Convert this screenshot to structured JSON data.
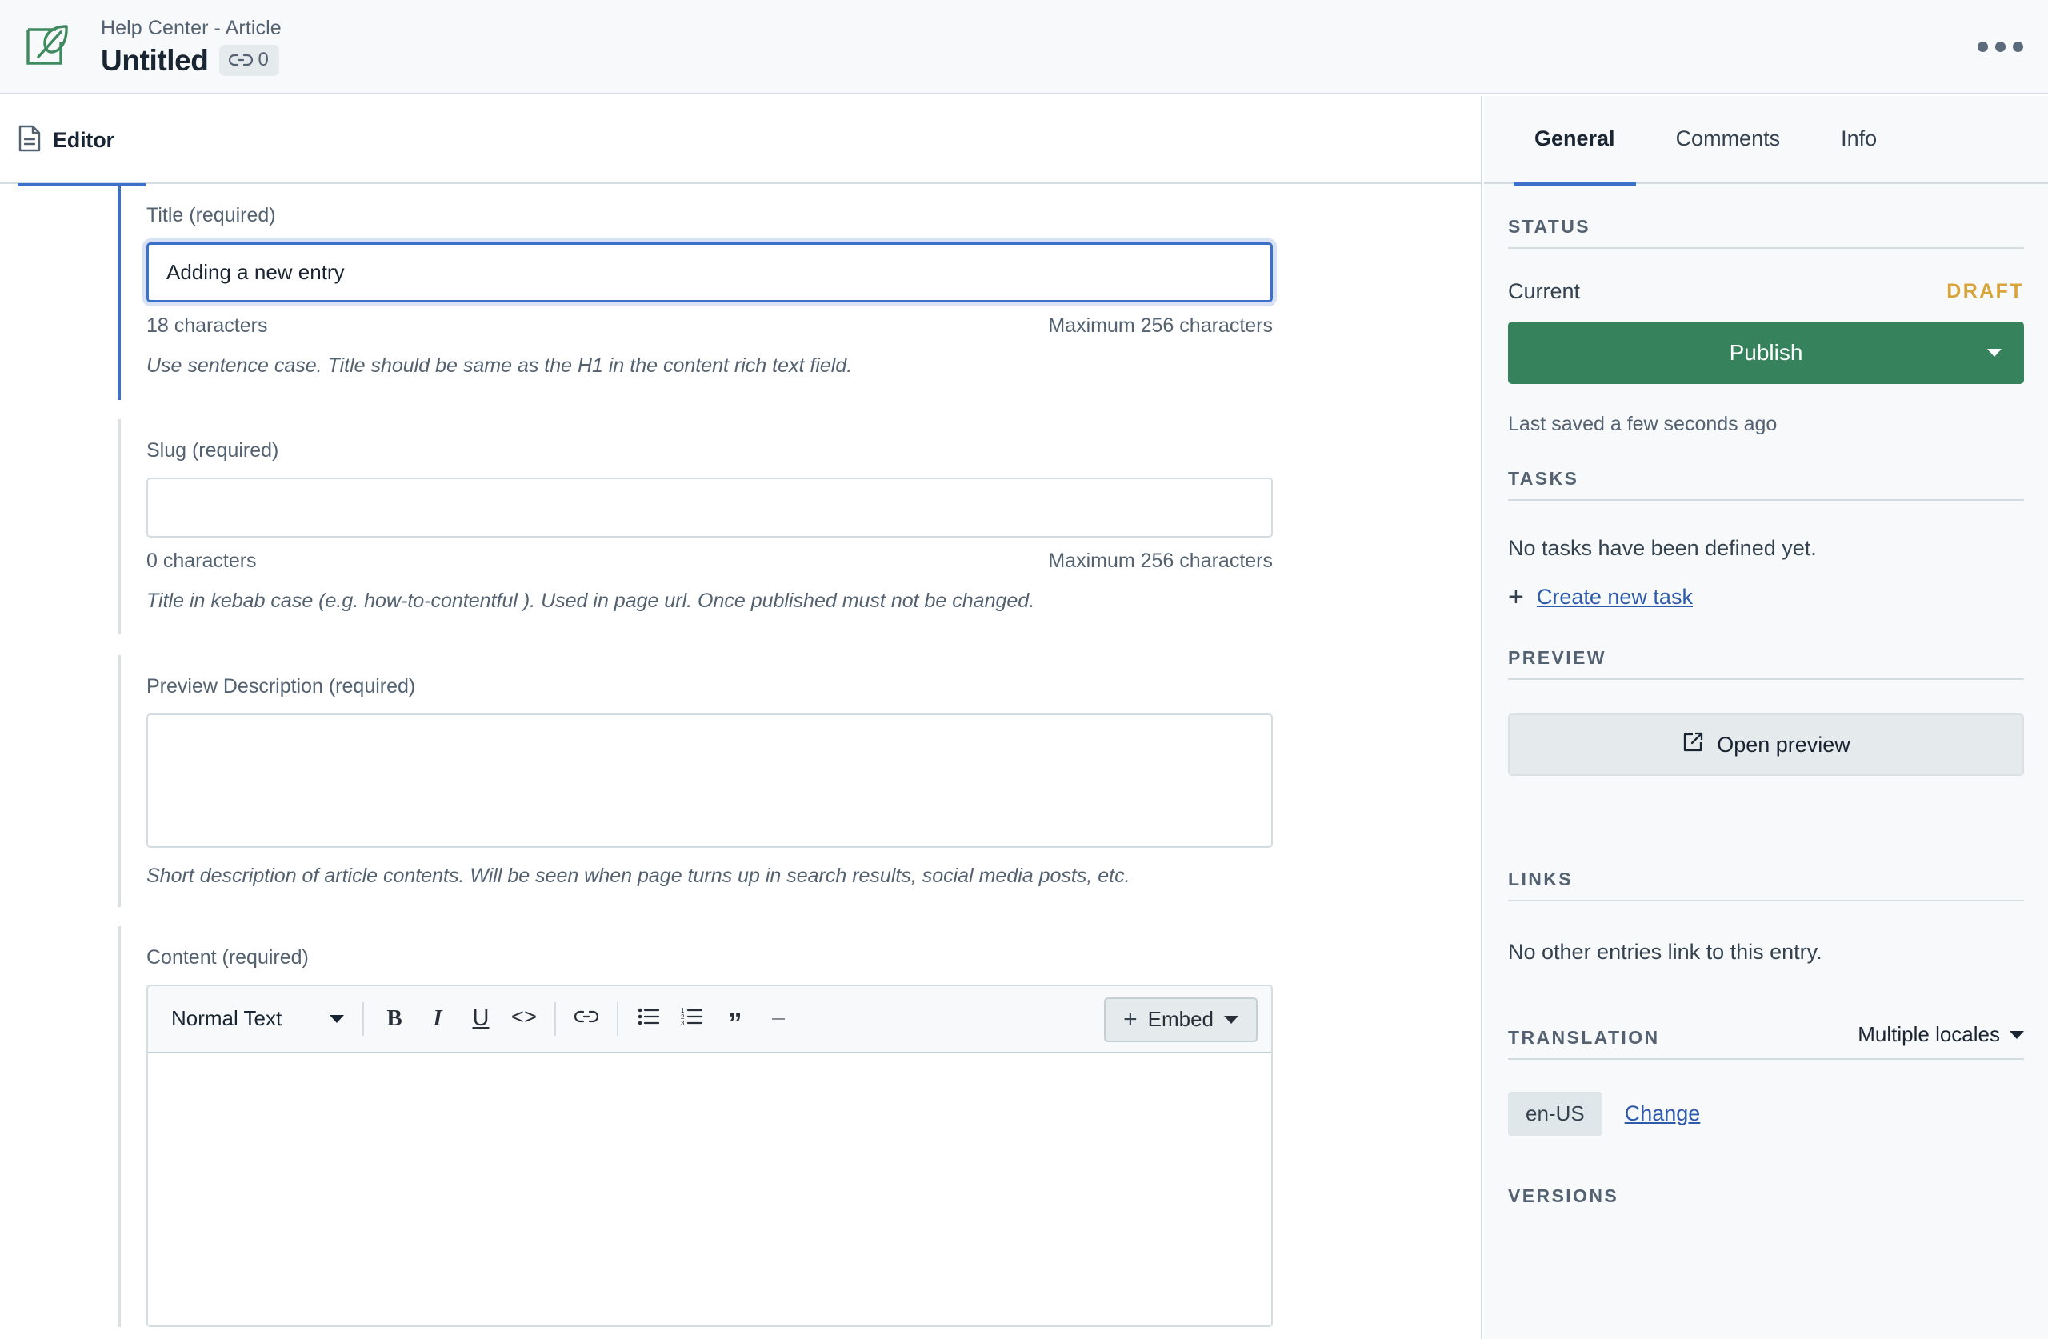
{
  "header": {
    "breadcrumb": "Help Center - Article",
    "entry_title": "Untitled",
    "link_count": "0",
    "logo_icon": "leaf-document-icon",
    "more_menu_icon": "ellipsis-icon"
  },
  "editor": {
    "tab_label": "Editor",
    "tab_icon": "document-icon",
    "fields": {
      "title": {
        "label": "Title (required)",
        "value": "Adding a new entry",
        "char_count": "18 characters",
        "max_chars": "Maximum 256 characters",
        "helper": "Use sentence case. Title should be same as the H1 in the content rich text field."
      },
      "slug": {
        "label": "Slug (required)",
        "value": "",
        "char_count": "0 characters",
        "max_chars": "Maximum 256 characters",
        "helper": "Title in kebab case (e.g. how-to-contentful ). Used in page url. Once published must not be changed."
      },
      "preview_description": {
        "label": "Preview Description (required)",
        "value": "",
        "helper": "Short description of article contents. Will be seen when page turns up in search results, social media posts, etc."
      },
      "content": {
        "label": "Content (required)",
        "style_select": "Normal Text",
        "toolbar": [
          {
            "name": "bold-button",
            "glyph": "B"
          },
          {
            "name": "italic-button",
            "glyph": "I"
          },
          {
            "name": "underline-button",
            "glyph": "U"
          },
          {
            "name": "code-button",
            "glyph": "<>"
          },
          {
            "name": "link-button",
            "glyph": "link"
          },
          {
            "name": "bulleted-list-button",
            "glyph": "ul"
          },
          {
            "name": "numbered-list-button",
            "glyph": "ol"
          },
          {
            "name": "blockquote-button",
            "glyph": "”"
          },
          {
            "name": "horizontal-rule-button",
            "glyph": "—"
          }
        ],
        "embed_label": "Embed"
      }
    }
  },
  "sidebar": {
    "tabs": [
      {
        "label": "General",
        "active": true
      },
      {
        "label": "Comments",
        "active": false
      },
      {
        "label": "Info",
        "active": false
      }
    ],
    "status": {
      "section_title": "STATUS",
      "current_label": "Current",
      "current_value": "DRAFT",
      "publish_label": "Publish",
      "last_saved": "Last saved a few seconds ago"
    },
    "tasks": {
      "section_title": "TASKS",
      "empty_text": "No tasks have been defined yet.",
      "create_label": "Create new task"
    },
    "preview": {
      "section_title": "PREVIEW",
      "open_label": "Open preview",
      "open_icon": "external-link-icon"
    },
    "links": {
      "section_title": "LINKS",
      "empty_text": "No other entries link to this entry."
    },
    "translation": {
      "section_title": "TRANSLATION",
      "selector_value": "Multiple locales",
      "locale_chip": "en-US",
      "change_label": "Change"
    },
    "versions": {
      "section_title": "VERSIONS"
    }
  },
  "colors": {
    "accent_blue": "#3c70c9",
    "publish_green": "#36825c",
    "draft_amber": "#d9a43b",
    "link_blue": "#2e5aac",
    "logo_green": "#3f8a5f",
    "panel_bg": "#f7f9fa",
    "border": "#d3dce0"
  }
}
